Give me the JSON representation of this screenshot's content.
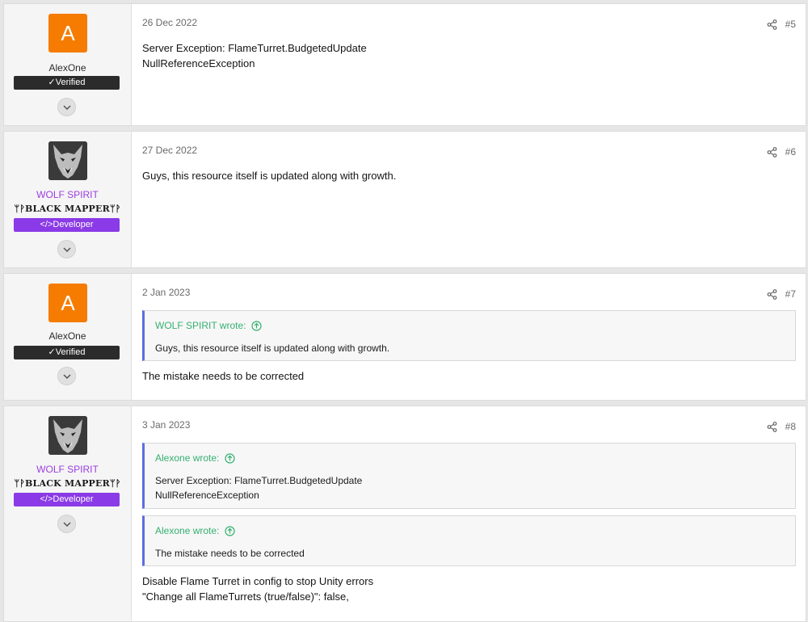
{
  "posts": [
    {
      "author": "AlexOne",
      "avatar_letter": "A",
      "badge": "✓Verified",
      "date": "26 Dec 2022",
      "number": "#5",
      "body": [
        "Server Exception: FlameTurret.BudgetedUpdate",
        "NullReferenceException"
      ]
    },
    {
      "author": "WOLF SPIRIT",
      "subtitle": "ᛘᚹBLACK MAPPERᛘᚹ",
      "badge": "</>Developer",
      "date": "27 Dec 2022",
      "number": "#6",
      "body": [
        "Guys, this resource itself is updated along with growth."
      ]
    },
    {
      "author": "AlexOne",
      "avatar_letter": "A",
      "badge": "✓Verified",
      "date": "2 Jan 2023",
      "number": "#7",
      "quote": {
        "head": "WOLF SPIRIT wrote:",
        "body": [
          "Guys, this resource itself is updated along with growth."
        ]
      },
      "body": [
        "The mistake needs to be corrected"
      ]
    },
    {
      "author": "WOLF SPIRIT",
      "subtitle": "ᛘᚹBLACK MAPPERᛘᚹ",
      "badge": "</>Developer",
      "date": "3 Jan 2023",
      "number": "#8",
      "quotes": [
        {
          "head": "Alexone wrote:",
          "body": [
            "Server Exception: FlameTurret.BudgetedUpdate",
            "NullReferenceException"
          ]
        },
        {
          "head": "Alexone wrote:",
          "body": [
            "The mistake needs to be corrected"
          ]
        }
      ],
      "body": [
        "Disable Flame Turret in config to stop Unity errors",
        "\"Change all FlameTurrets (true/false)\": false,"
      ]
    }
  ],
  "colors": {
    "verified_badge": "#2b2b2b",
    "developer_badge": "#8a3ae6",
    "developer_name": "#9b3de0",
    "avatar_orange": "#f57c00",
    "quote_head": "#35b070",
    "quote_border": "#5b6ee1"
  },
  "icons": {
    "share": "share-icon",
    "expand": "chevron-down-icon",
    "quote_jump": "arrow-up-circle-icon"
  }
}
